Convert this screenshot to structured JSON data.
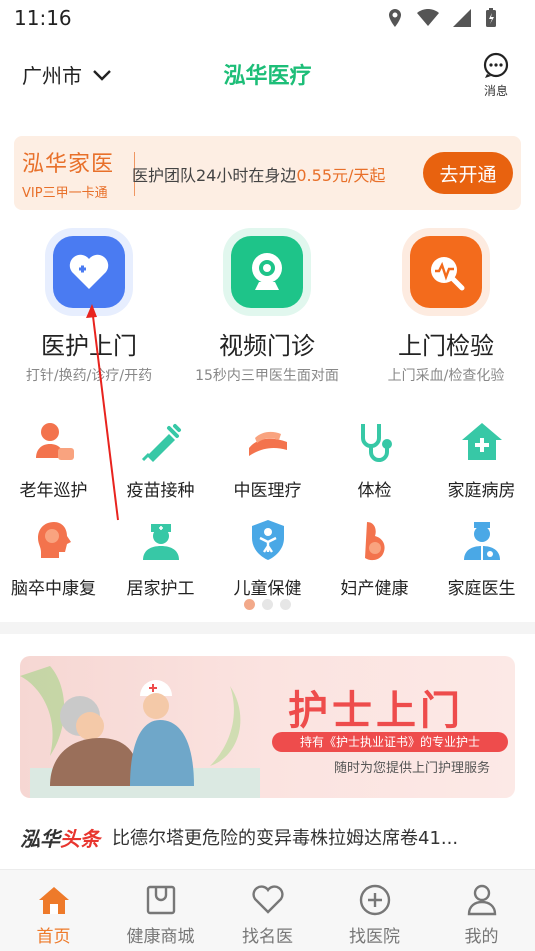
{
  "status": {
    "time": "11:16"
  },
  "header": {
    "city": "广州市",
    "title": "泓华医疗",
    "message_label": "消息"
  },
  "vip": {
    "brand": "泓华家医",
    "sub": "VIP三甲一卡通",
    "desc_prefix": "医护团队24小时在身边",
    "price": "0.55元/天起",
    "button": "去开通"
  },
  "big_services": [
    {
      "title": "医护上门",
      "sub": "打针/换药/诊疗/开药",
      "color": "#4a7bf2",
      "icon": "heart-plus-icon"
    },
    {
      "title": "视频门诊",
      "sub": "15秒内三甲医生面对面",
      "color": "#1ec489",
      "icon": "video-camera-icon"
    },
    {
      "title": "上门检验",
      "sub": "上门采血/检查化验",
      "color": "#f36b1c",
      "icon": "test-magnifier-icon"
    }
  ],
  "grid_row1": [
    {
      "label": "老年巡护",
      "icon": "elderly-patrol-icon"
    },
    {
      "label": "疫苗接种",
      "icon": "syringe-icon"
    },
    {
      "label": "中医理疗",
      "icon": "massage-hand-icon"
    },
    {
      "label": "体检",
      "icon": "stethoscope-icon"
    },
    {
      "label": "家庭病房",
      "icon": "home-cross-icon"
    }
  ],
  "grid_row2": [
    {
      "label": "脑卒中康复",
      "icon": "brain-head-icon"
    },
    {
      "label": "居家护工",
      "icon": "nurse-icon"
    },
    {
      "label": "儿童保健",
      "icon": "child-shield-icon"
    },
    {
      "label": "妇产健康",
      "icon": "pregnant-icon"
    },
    {
      "label": "家庭医生",
      "icon": "doctor-icon"
    }
  ],
  "promo": {
    "title": "护士上门",
    "pill": "持有《护士执业证书》的专业护士",
    "sub": "随时为您提供上门护理服务"
  },
  "news": {
    "brand_a": "泓华",
    "brand_b": "头条",
    "text": "比德尔塔更危险的变异毒株拉姆达席卷41..."
  },
  "tabs": [
    {
      "label": "首页",
      "icon": "home-icon",
      "active": true
    },
    {
      "label": "健康商城",
      "icon": "shop-bag-icon",
      "active": false
    },
    {
      "label": "找名医",
      "icon": "heart-outline-icon",
      "active": false
    },
    {
      "label": "找医院",
      "icon": "plus-circle-icon",
      "active": false
    },
    {
      "label": "我的",
      "icon": "person-icon",
      "active": false
    }
  ],
  "colors": {
    "brand_green": "#1dbe78",
    "accent_orange": "#e8620f",
    "tab_active": "#ee7a2a"
  }
}
